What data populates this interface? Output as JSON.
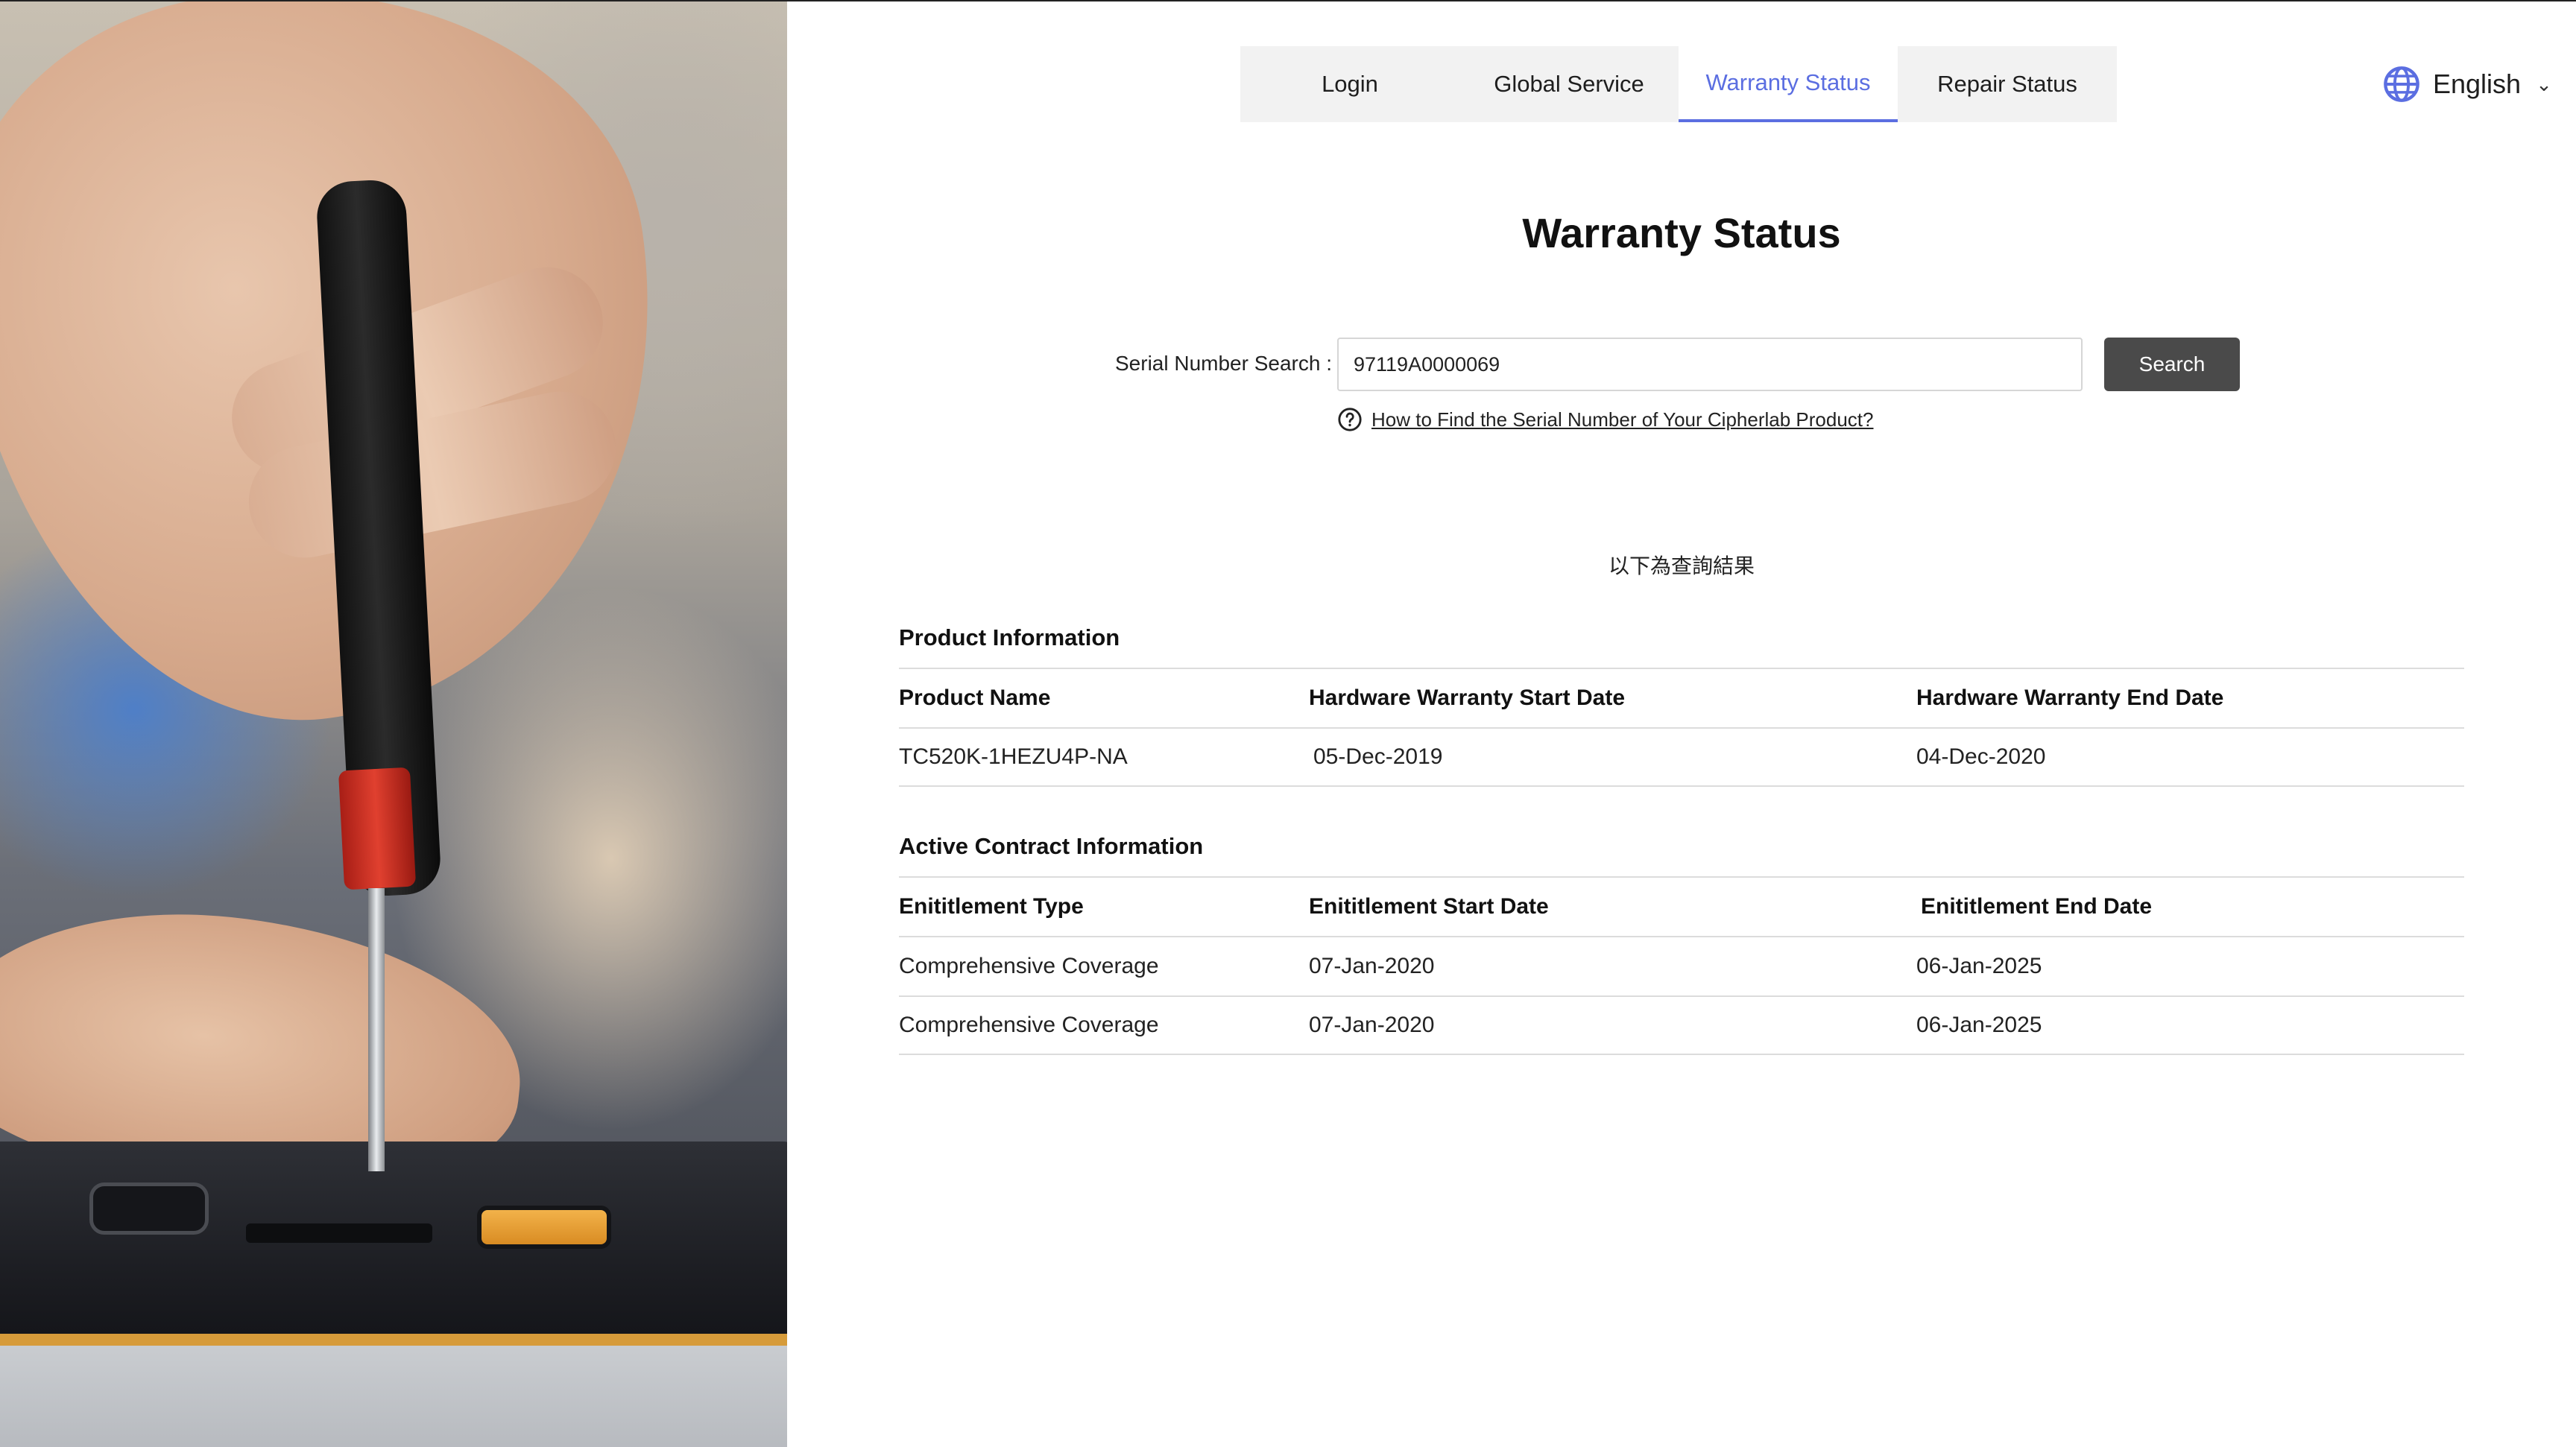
{
  "tabs": [
    {
      "label": "Login"
    },
    {
      "label": "Global Service"
    },
    {
      "label": "Warranty Status"
    },
    {
      "label": "Repair Status"
    }
  ],
  "active_tab": "Warranty Status",
  "language": {
    "label": "English",
    "icon": "globe-icon",
    "accent": "#5b6ee1"
  },
  "page_title": "Warranty Status",
  "search": {
    "label": "Serial Number Search :",
    "value": "97119A0000069",
    "button": "Search",
    "help_link": "How to Find the Serial Number of Your Cipherlab Product?"
  },
  "result_message": "以下為查詢結果",
  "product_info": {
    "title": "Product Information",
    "headers": [
      "Product Name",
      "Hardware Warranty Start Date",
      "Hardware Warranty End Date"
    ],
    "rows": [
      [
        "TC520K-1HEZU4P-NA",
        "05-Dec-2019",
        "04-Dec-2020"
      ]
    ]
  },
  "contract_info": {
    "title": "Active Contract Information",
    "headers": [
      "Enititlement Type",
      "Enititlement Start Date",
      "Enititlement End Date"
    ],
    "rows": [
      [
        "Comprehensive Coverage",
        "07-Jan-2020",
        "06-Jan-2025"
      ],
      [
        "Comprehensive Coverage",
        "07-Jan-2020",
        "06-Jan-2025"
      ]
    ]
  },
  "colors": {
    "active_tab": "#5b6ee1",
    "button_bg": "#4a4a4a",
    "tab_bg": "#f2f2f2"
  }
}
